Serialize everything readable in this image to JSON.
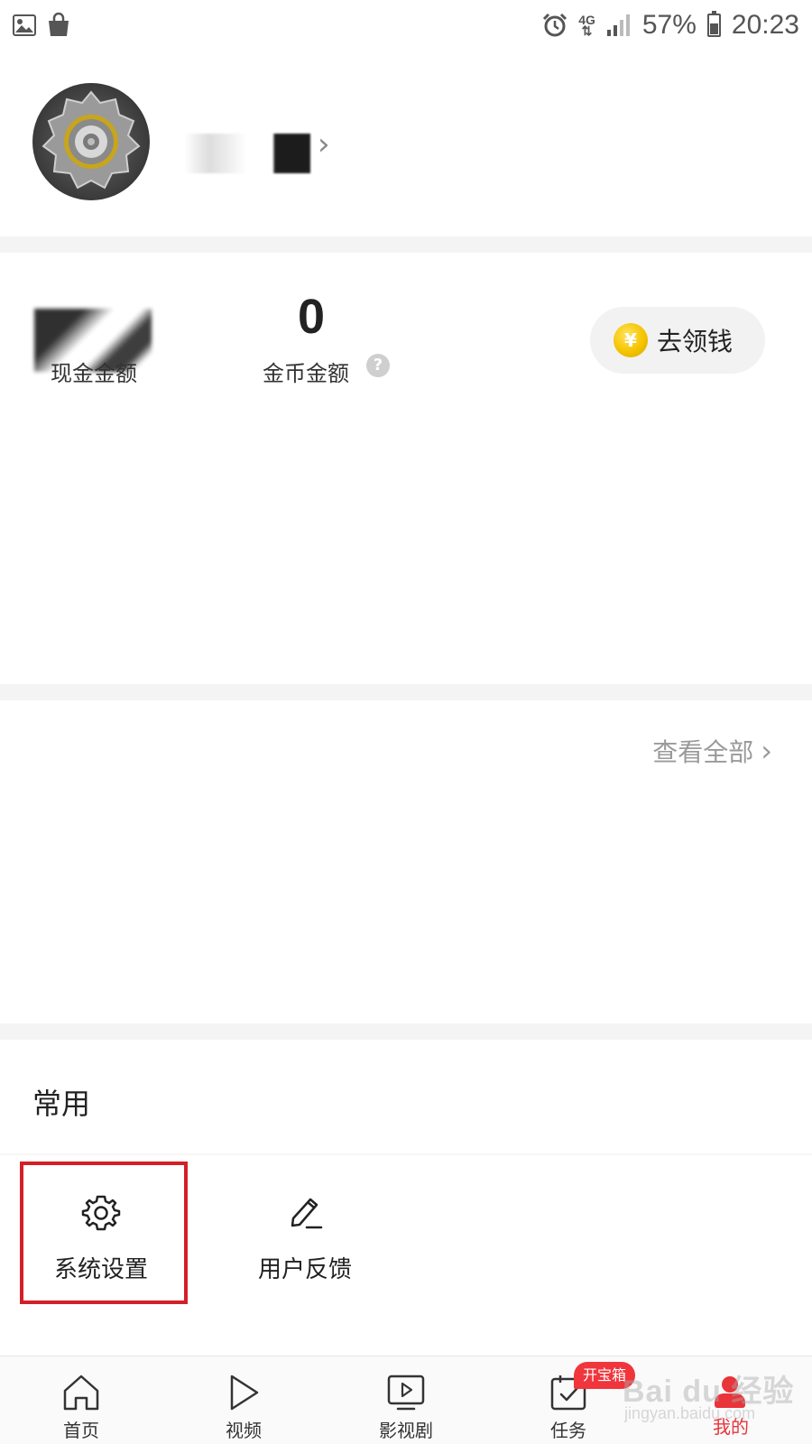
{
  "status_bar": {
    "network": "4G",
    "battery": "57%",
    "time": "20:23",
    "left_icons": [
      "image-icon",
      "shopping-bag-icon"
    ],
    "right_icons": [
      "alarm-icon",
      "signal-icon",
      "battery-icon"
    ]
  },
  "profile": {
    "nickname": "",
    "chevron": "›"
  },
  "wallet": {
    "cash_label": "现金金额",
    "coin_value": "0",
    "coin_label": "金币金额",
    "help_glyph": "?",
    "earn_button_label": "去领钱",
    "coin_glyph": "¥"
  },
  "history": {
    "view_all_label": "查看全部",
    "view_all_chevron": "›"
  },
  "common": {
    "title": "常用",
    "tools": [
      {
        "label": "系统设置",
        "icon": "gear-icon"
      },
      {
        "label": "用户反馈",
        "icon": "pencil-icon"
      }
    ]
  },
  "bottom_nav": {
    "items": [
      {
        "label": "首页",
        "icon": "home-icon"
      },
      {
        "label": "视频",
        "icon": "play-icon"
      },
      {
        "label": "影视剧",
        "icon": "tv-icon"
      },
      {
        "label": "任务",
        "icon": "calendar-check-icon"
      },
      {
        "label": "我的",
        "icon": "user-icon",
        "active": true
      }
    ],
    "badge": "开宝箱"
  },
  "watermark": {
    "main": "Bai du 经验",
    "sub": "jingyan.baidu.com"
  },
  "colors": {
    "accent": "#e8343a",
    "highlight_border": "#d41f26",
    "coin": "#f5c400",
    "divider": "#f4f4f4"
  }
}
